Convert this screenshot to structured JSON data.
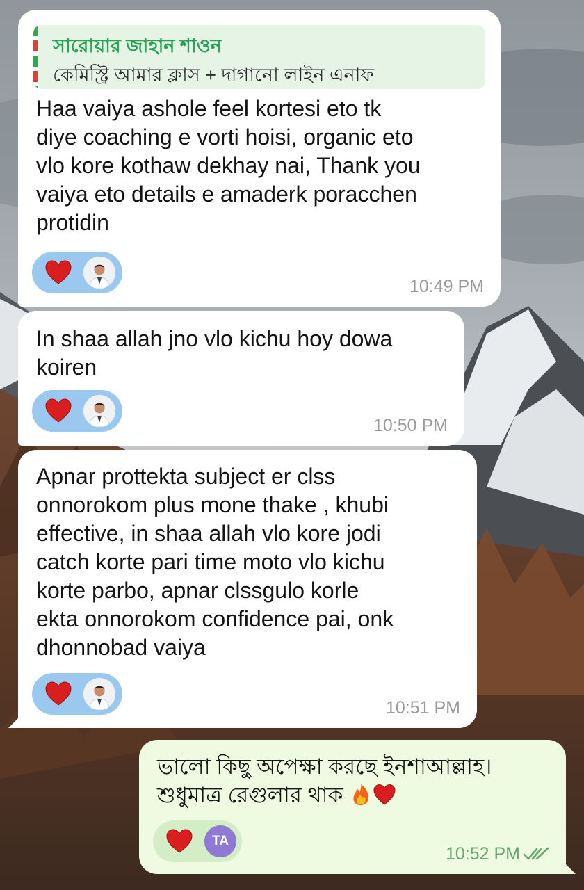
{
  "messages": [
    {
      "reply": {
        "author": "সারোয়ার জাহান শাওন",
        "text": "কেমিস্ট্রি আমার ক্লাস + দাগানো লাইন এনাফ"
      },
      "lines": "Haa vaiya ashole feel kortesi eto tk\ndiye coaching e vorti hoisi, organic eto\nvlo kore kothaw dekhay nai, Thank you\nvaiya eto details e amaderk poracchen\nprotidin",
      "reaction": "heart",
      "time": "10:49 PM"
    },
    {
      "lines": "In shaa allah jno vlo kichu hoy dowa\nkoiren",
      "reaction": "heart",
      "time": "10:50 PM"
    },
    {
      "lines": "Apnar prottekta subject er clss\nonnorokom plus mone thake , khubi\neffective, in shaa allah vlo kore jodi\ncatch korte pari time moto vlo kichu\nkorte parbo, apnar clssgulo korle\nekta onnorokom confidence pai, onk\ndhonnobad vaiya",
      "reaction": "heart",
      "time": "10:51 PM"
    },
    {
      "line1": "ভালো কিছু অপেক্ষা করছে ইনশাআল্লাহ।",
      "line2": "শুধুমাত্র রেগুলার থাক",
      "emojis": [
        "fire",
        "heart"
      ],
      "reaction": "heart",
      "reactor_initials": "TA",
      "time": "10:52 PM",
      "status": "read-double-check"
    }
  ],
  "colors": {
    "incoming_bubble": "#ffffff",
    "outgoing_bubble": "#eefbe0",
    "reply_author": "#29a355",
    "reaction_pill_in": "#9bc8ef",
    "reaction_pill_out": "#d3edc6",
    "time_out": "#64a86b",
    "heart": "#d81e1e"
  }
}
